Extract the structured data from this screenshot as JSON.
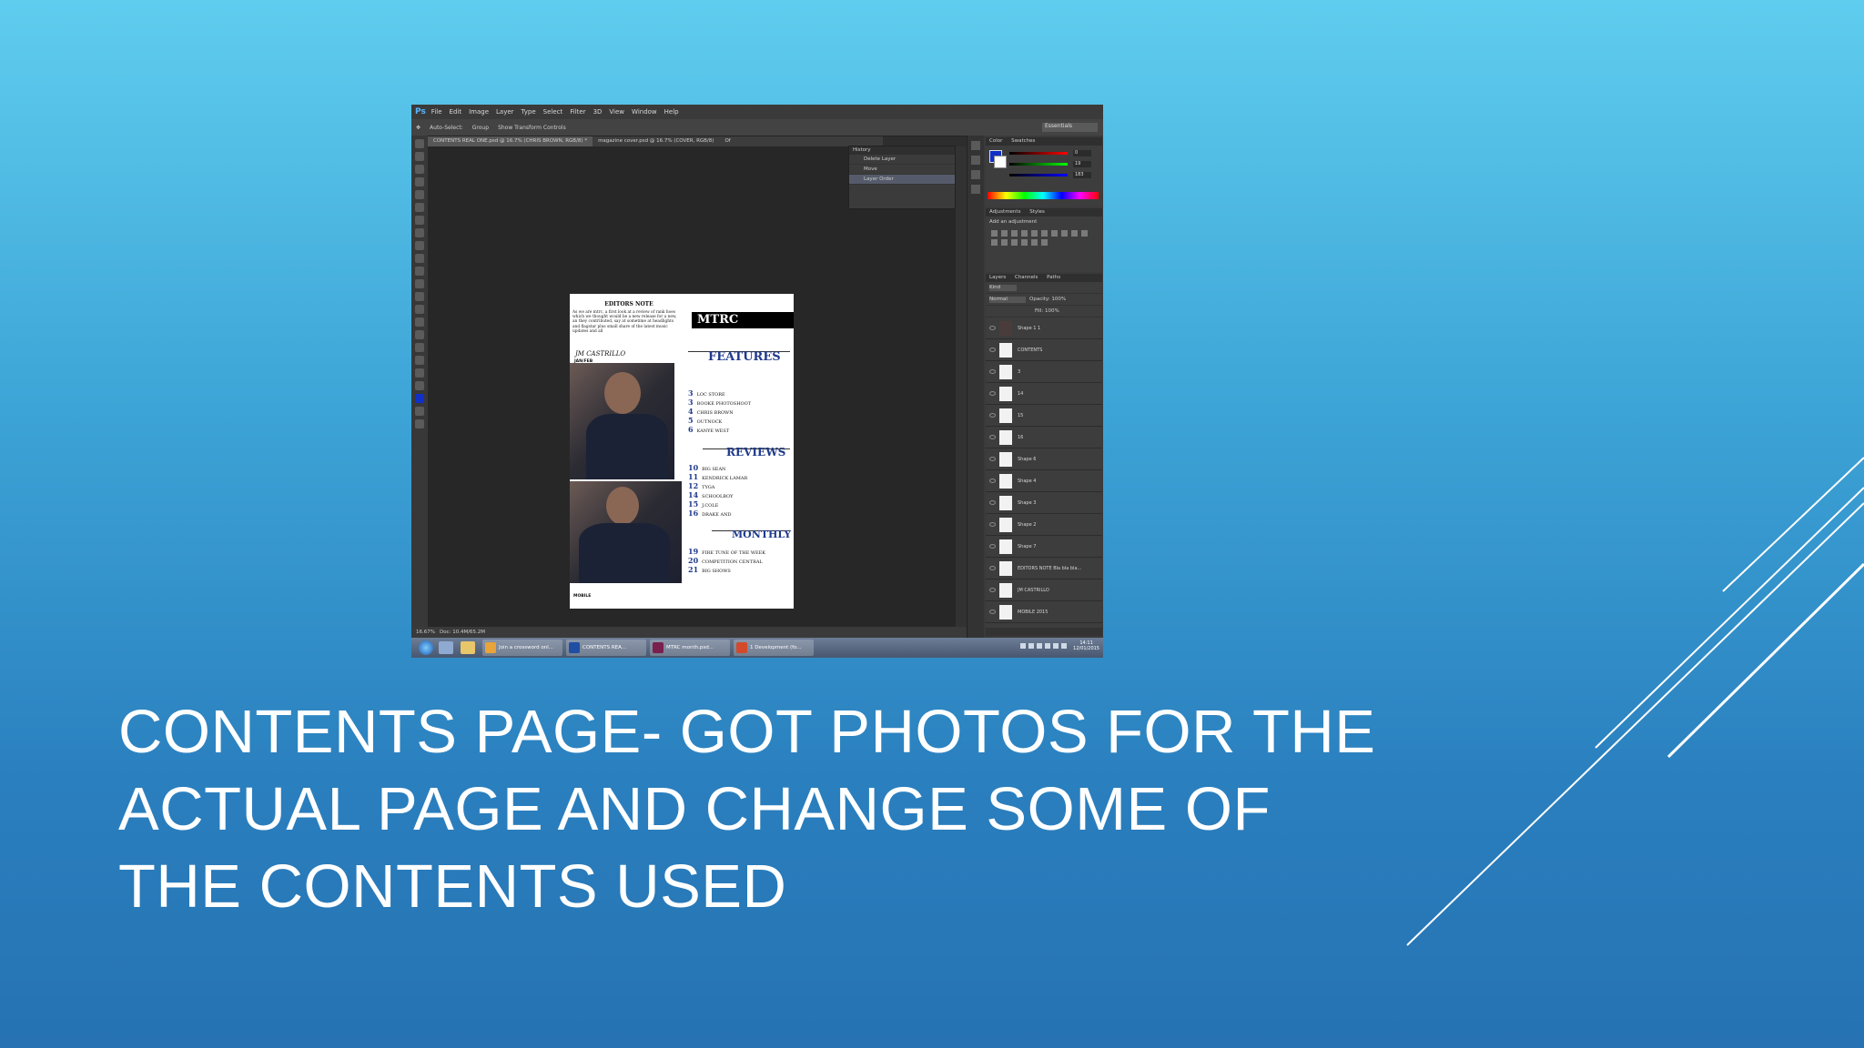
{
  "slide": {
    "title_lines": [
      "CONTENTS PAGE- GOT PHOTOS FOR THE",
      "ACTUAL PAGE AND CHANGE SOME OF",
      "THE CONTENTS USED"
    ],
    "colors": {
      "background_top": "#5fcdee",
      "background_bottom": "#2672b2",
      "title": "#ffffff",
      "decor_lines": "#ffffff"
    }
  },
  "screenshot": {
    "app_icon": "Ps",
    "menu": [
      "File",
      "Edit",
      "Image",
      "Layer",
      "Type",
      "Select",
      "Filter",
      "3D",
      "View",
      "Window",
      "Help"
    ],
    "options": [
      "Auto-Select:",
      "Group",
      "Show Transform Controls"
    ],
    "workspace": "Essentials",
    "tabs": [
      "CONTENTS REAL ONE.psd @ 16.7% (CHRIS BROWN, RGB/8) *",
      "magazine cover.psd @ 16.7% (COVER, RGB/8)",
      "Of"
    ],
    "history": {
      "title": "History",
      "rows": [
        "Delete Layer",
        "Move",
        "Layer Order"
      ]
    },
    "document": {
      "editors_note_title": "EDITORS NOTE",
      "editors_note_text": "As we are mtrc, a first look at a review of rank hoes which we thought would be a new release for a new, an they contributed, say at sometime at headlights and flagstar plus small share of the latest music updates and all",
      "signature": "JM CASTRILLO",
      "signature_lines": [
        "JAN/FEB",
        "2015"
      ],
      "masthead": "MTRC",
      "sections": [
        {
          "title": "FEATURES",
          "items": [
            {
              "num": "3",
              "text": "LOC STORE"
            },
            {
              "num": "3",
              "text": "BOOKE PHOTOSHOOT"
            },
            {
              "num": "4",
              "text": "CHRIS BROWN"
            },
            {
              "num": "5",
              "text": "OUTNOCK"
            },
            {
              "num": "6",
              "text": "KANYE WEST"
            }
          ]
        },
        {
          "title": "REVIEWS",
          "items": [
            {
              "num": "10",
              "text": "BIG SEAN"
            },
            {
              "num": "11",
              "text": "KENDRICK LAMAR"
            },
            {
              "num": "12",
              "text": "TYGA"
            },
            {
              "num": "14",
              "text": "SCHOOLBOY"
            },
            {
              "num": "15",
              "text": "J.COLE"
            },
            {
              "num": "16",
              "text": "DRAKE AND"
            }
          ]
        },
        {
          "title": "MONTHLY",
          "items": [
            {
              "num": "19",
              "text": "FIRE TUNE OF THE WEEK"
            },
            {
              "num": "20",
              "text": "COMPETITION CENTRAL"
            },
            {
              "num": "21",
              "text": "BIG SHOWS"
            }
          ]
        }
      ],
      "footer": "MOBILE"
    },
    "status": {
      "zoom": "16.67%",
      "doc": "Doc: 10.4M/65.2M"
    },
    "color_panel": {
      "tabs": [
        "Color",
        "Swatches"
      ],
      "values": [
        "0",
        "19",
        "183"
      ]
    },
    "adjustments": {
      "tabs": [
        "Adjustments",
        "Styles"
      ],
      "hint": "Add an adjustment"
    },
    "layers": {
      "tabs": [
        "Layers",
        "Channels",
        "Paths"
      ],
      "mode": "Normal",
      "opacity": "Opacity: 100%",
      "fill": "Fill: 100%",
      "kind": "Kind",
      "items": [
        "Shape 1 1",
        "CONTENTS",
        "3",
        "14",
        "15",
        "16",
        "Shape 6",
        "Shape 4",
        "Shape 3",
        "Shape 2",
        "Shape 7",
        "EDITORS NOTE Bla bla bla...",
        "JM CASTRILLO",
        "MOBILE 2015"
      ]
    },
    "taskbar": {
      "buttons": [
        {
          "label": "Join a crossword onl...",
          "color": "#e8a33b"
        },
        {
          "label": "CONTENTS REA...",
          "color": "#1f4ea3"
        },
        {
          "label": "MTRC month.psd...",
          "color": "#7a1f4e"
        },
        {
          "label": "1 Development (fo...",
          "color": "#d24a2b"
        }
      ],
      "time": "14:11",
      "date": "12/01/2015"
    }
  }
}
